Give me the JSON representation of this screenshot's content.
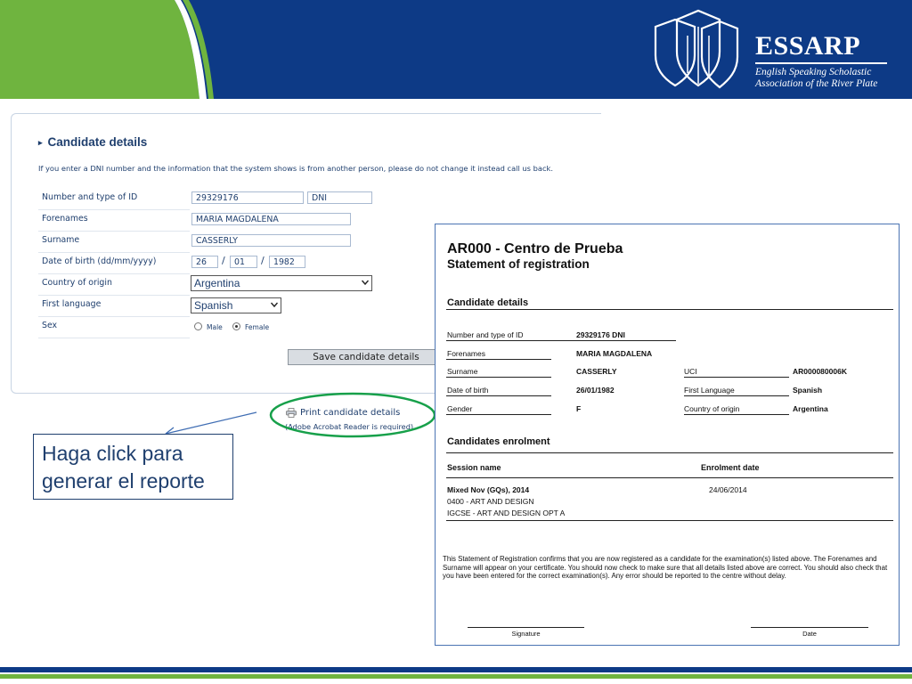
{
  "header": {
    "org_name": "ESSARP",
    "org_full_line1": "English Speaking Scholastic",
    "org_full_line2": "Association of the River Plate",
    "colors": {
      "navy": "#0d3a86",
      "green": "#6fb43f"
    }
  },
  "form": {
    "title": "Candidate details",
    "note": "If you enter a DNI number and the information that the system shows is from another person, please do not change it instead call us back.",
    "labels": {
      "id": "Number and type of ID",
      "forenames": "Forenames",
      "surname": "Surname",
      "dob": "Date of birth (dd/mm/yyyy)",
      "country": "Country of origin",
      "language": "First language",
      "sex": "Sex"
    },
    "values": {
      "id_number": "29329176",
      "id_type": "DNI",
      "forenames": "MARIA MAGDALENA",
      "surname": "CASSERLY",
      "dob_day": "26",
      "dob_month": "01",
      "dob_year": "1982",
      "date_sep": "/",
      "country": "Argentina",
      "language": "Spanish"
    },
    "sex_options": {
      "male": "Male",
      "female": "Female",
      "selected": "Female"
    },
    "save_label": "Save candidate details",
    "print_label": "Print candidate details",
    "print_note": "(Adobe Acrobat Reader is required)"
  },
  "callout": {
    "line1": "Haga click para",
    "line2": "generar el reporte"
  },
  "report": {
    "title": "AR000 - Centro de Prueba",
    "subtitle": "Statement of registration",
    "section_candidate": "Candidate details",
    "fields": {
      "id_label": "Number and type of ID",
      "id_value": "29329176 DNI",
      "forenames_label": "Forenames",
      "forenames_value": "MARIA MAGDALENA",
      "surname_label": "Surname",
      "surname_value": "CASSERLY",
      "uci_label": "UCI",
      "uci_value": "AR000080006K",
      "dob_label": "Date of birth",
      "dob_value": "26/01/1982",
      "lang_label": "First Language",
      "lang_value": "Spanish",
      "gender_label": "Gender",
      "gender_value": "F",
      "country_label": "Country of origin",
      "country_value": "Argentina"
    },
    "section_enrolment": "Candidates enrolment",
    "enrol_headers": {
      "session": "Session name",
      "date": "Enrolment date"
    },
    "enrolment": {
      "session": "Mixed Nov (GQs), 2014",
      "date": "24/06/2014",
      "subject1": "0400 - ART AND DESIGN",
      "subject2": "IGCSE  - ART AND DESIGN OPT A"
    },
    "statement": "This Statement of Registration confirms that you are now registered as a candidate for the examination(s) listed above. The Forenames and Surname will appear on your certificate. You should now check to make sure that all details listed above are correct. You should also check that you have been entered for the correct examination(s). Any error should be reported to the centre without delay.",
    "signature_label": "Signature",
    "date_label": "Date"
  }
}
